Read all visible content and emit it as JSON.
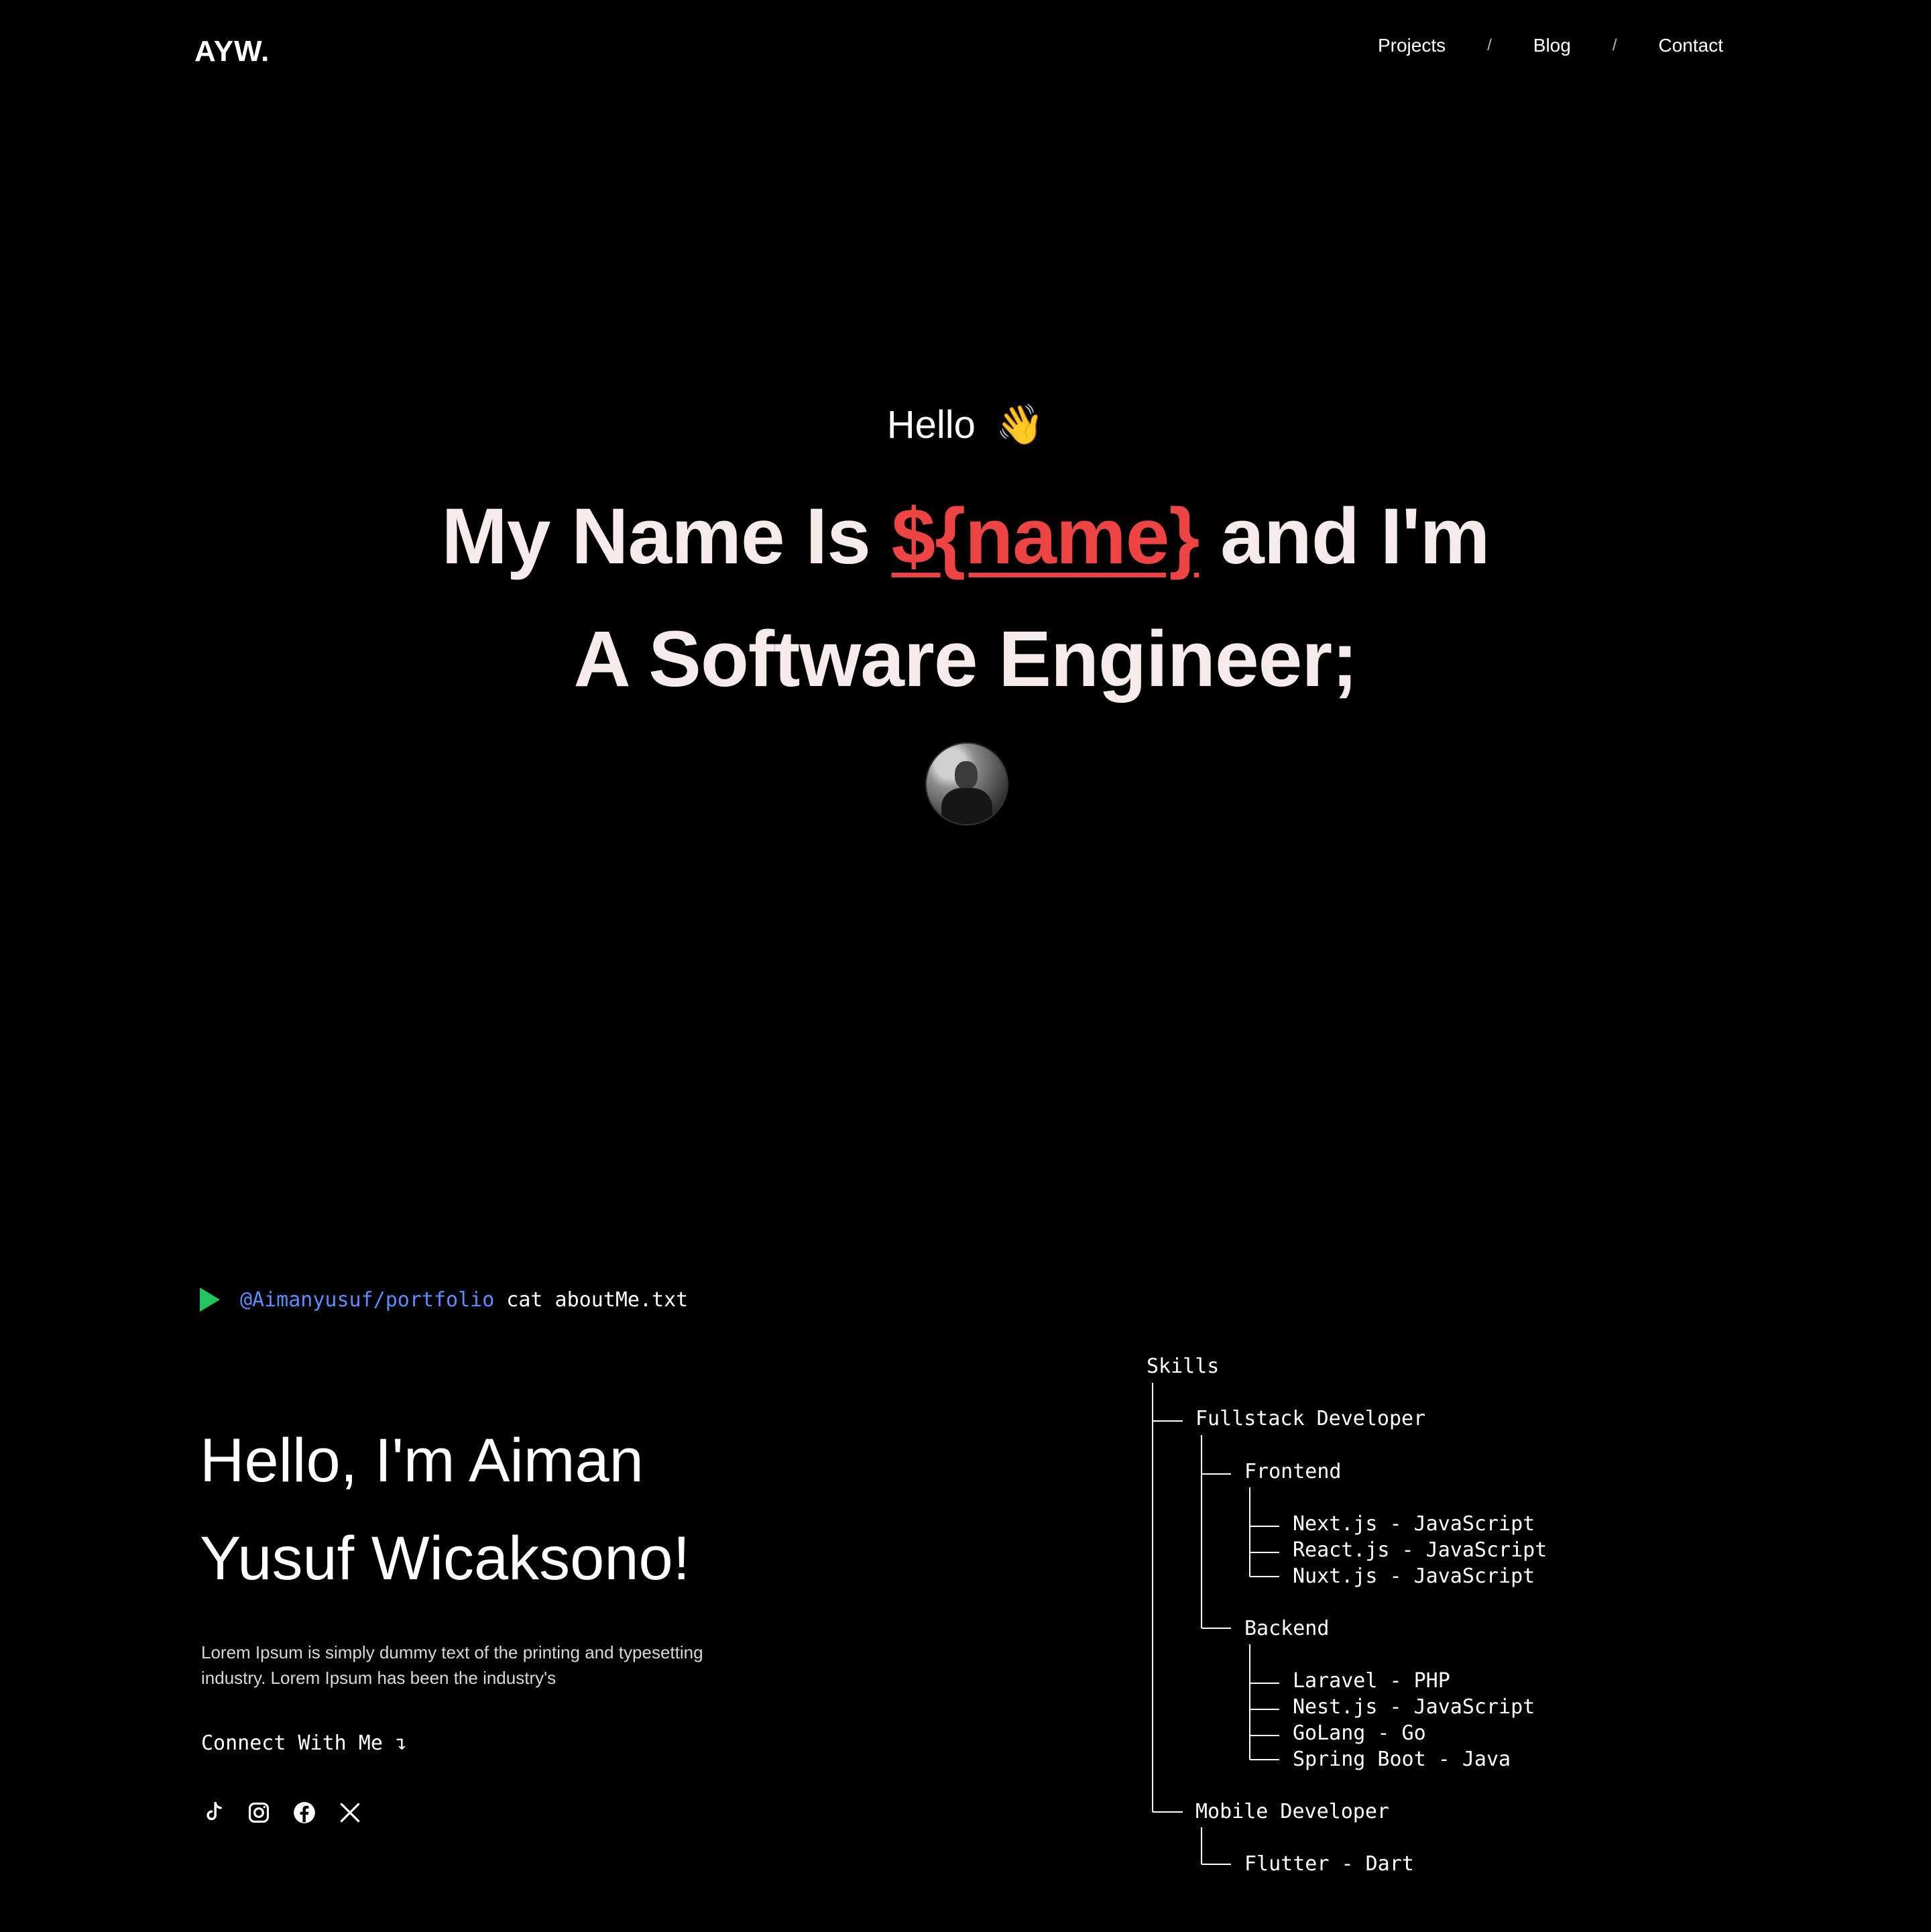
{
  "header": {
    "logo": "AYW.",
    "nav": [
      "Projects",
      "Blog",
      "Contact"
    ],
    "separator": "/"
  },
  "hero": {
    "greeting": "Hello",
    "greeting_emoji": "👋",
    "line1_prefix": "My Name Is ",
    "line1_accent": "${name}",
    "line1_suffix": " and I'm",
    "line2": "A Software Engineer;",
    "accent_color": "#ef4444"
  },
  "terminal": {
    "path": "@Aimanyusuf/portfolio",
    "command": "cat aboutMe.txt"
  },
  "about": {
    "title_line1": "Hello, I'm Aiman",
    "title_line2": "Yusuf Wicaksono!",
    "description": "Lorem Ipsum is simply dummy text of the printing and typesetting industry. Lorem Ipsum has been the industry's",
    "connect_label": "Connect With Me ↴",
    "socials": [
      "tiktok-icon",
      "instagram-icon",
      "facebook-icon",
      "x-icon"
    ]
  },
  "skills": {
    "root": "Skills",
    "fullstack": "Fullstack Developer",
    "frontend": "Frontend",
    "frontend_items": [
      "Next.js - JavaScript",
      "React.js - JavaScript",
      "Nuxt.js - JavaScript"
    ],
    "backend": "Backend",
    "backend_items": [
      "Laravel - PHP",
      "Nest.js - JavaScript",
      "GoLang - Go",
      "Spring Boot - Java"
    ],
    "mobile": "Mobile Developer",
    "mobile_items": [
      "Flutter - Dart"
    ]
  }
}
